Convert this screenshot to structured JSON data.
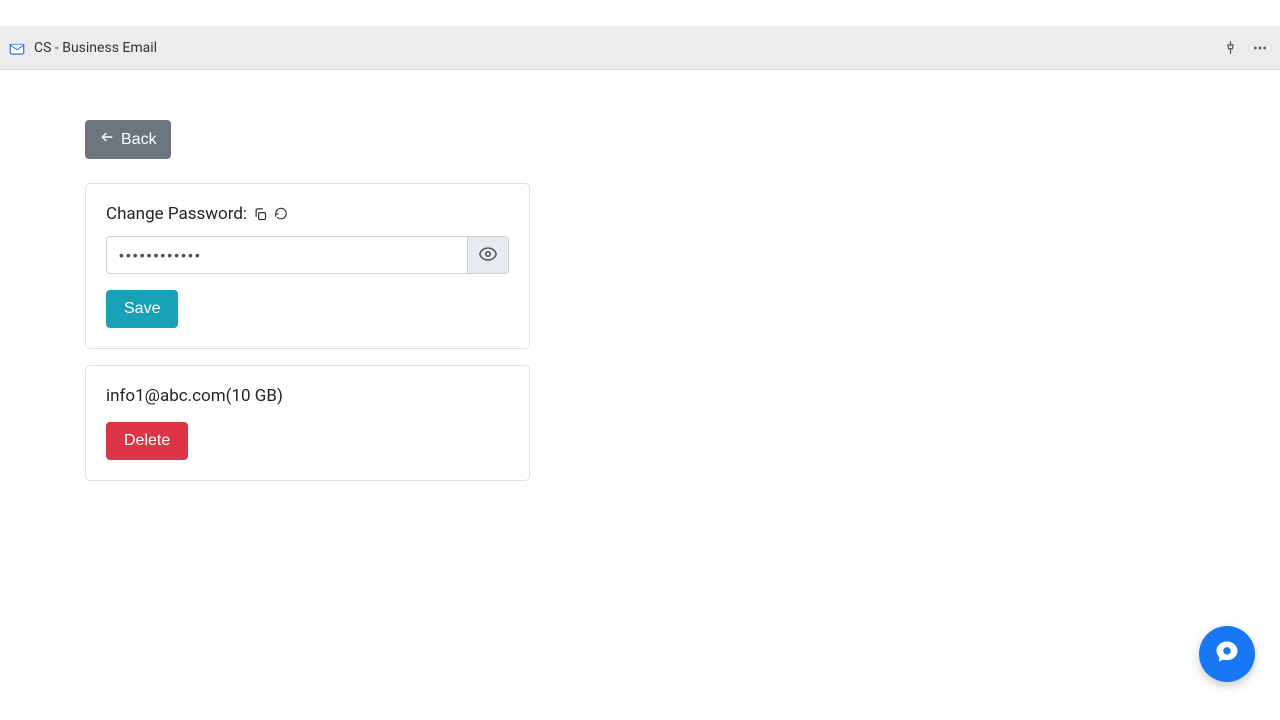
{
  "topbar": {
    "title": "CS - Business Email"
  },
  "back_button_label": "Back",
  "password_card": {
    "label": "Change Password:",
    "value": "••••••••••••",
    "save_label": "Save"
  },
  "account_card": {
    "email": "info1@abc.com",
    "size": "(10 GB)",
    "delete_label": "Delete"
  }
}
